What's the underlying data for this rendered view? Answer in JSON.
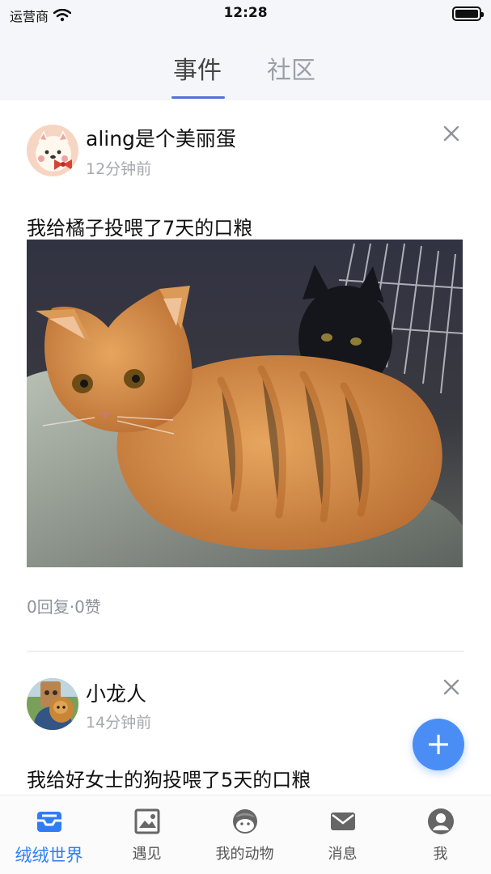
{
  "status_bar": {
    "carrier": "运营商",
    "time": "12:28",
    "battery_level": 1
  },
  "top_tabs": [
    {
      "label": "事件",
      "active": true
    },
    {
      "label": "社区",
      "active": false
    }
  ],
  "feed": {
    "posts": [
      {
        "author": "aling是个美丽蛋",
        "time": "12分钟前",
        "text": "我给橘子投喂了7天的口粮",
        "avatar_icon": "cartoon-cat-avatar",
        "photo_icon": "orange-cat-photo",
        "meta": "0回复·0赞"
      },
      {
        "author": "小龙人",
        "time": "14分钟前",
        "text": "我给好女士的狗投喂了5天的口粮",
        "avatar_icon": "person-with-dog-avatar",
        "photo_icon": "dog-photo"
      }
    ]
  },
  "fab": {
    "icon": "plus-icon",
    "label": "+"
  },
  "bottom_tabs": [
    {
      "label": "绒绒世界",
      "icon": "inbox-tray-icon",
      "active": true
    },
    {
      "label": "遇见",
      "icon": "image-frame-icon",
      "active": false
    },
    {
      "label": "我的动物",
      "icon": "pet-face-icon",
      "active": false
    },
    {
      "label": "消息",
      "icon": "mail-icon",
      "active": false
    },
    {
      "label": "我",
      "icon": "profile-icon",
      "active": false
    }
  ],
  "colors": {
    "accent": "#2f7cf6",
    "tab_underline": "#4f73d9",
    "muted_text": "#a5a8ae",
    "fab": "#4a8ef5"
  }
}
